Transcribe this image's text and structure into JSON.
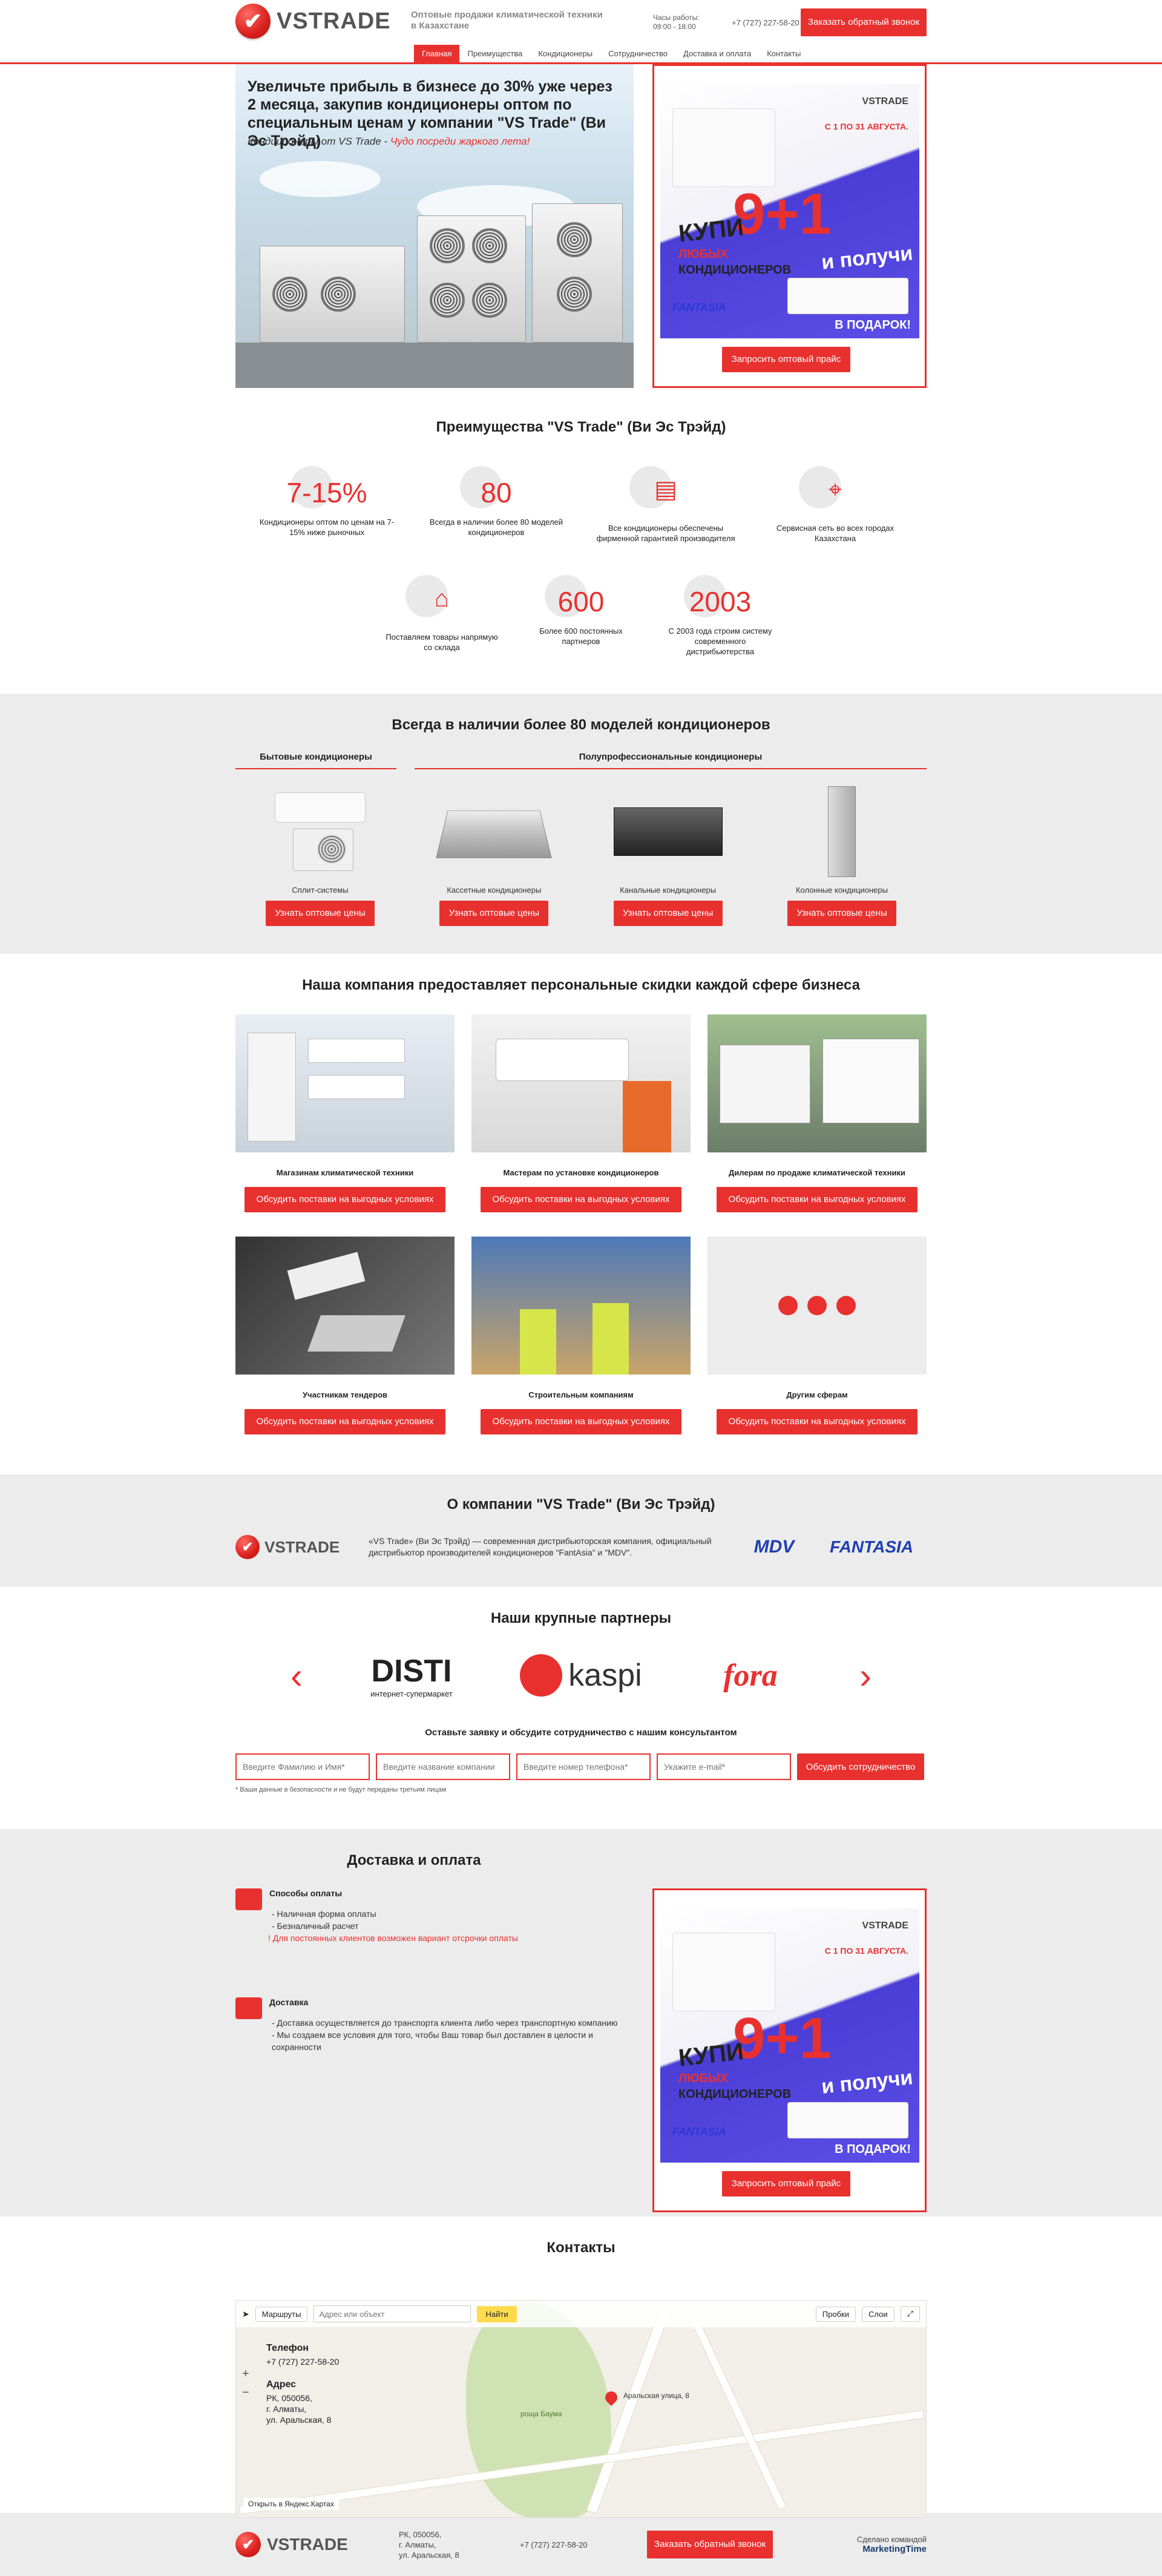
{
  "header": {
    "logo": "VSTRADE",
    "tagline": "Оптовые продажи климатической техники в Казахстане",
    "hours_label": "Часы работы:",
    "hours": "09:00 - 18:00",
    "phone": "+7 (727) 227-58-20",
    "callback_button": "Заказать обратный звонок",
    "nav": [
      "Главная",
      "Преимущества",
      "Кондиционеры",
      "Сотрудничество",
      "Доставка и оплата",
      "Контакты"
    ]
  },
  "hero": {
    "title": "Увеличьте прибыль в бизнесе до 30% уже через 2 месяца, закупив кондиционеры оптом по специальным ценам у компании \"VS Trade\" (Ви Эс Трэйд)",
    "subtitle_a": "Кондиционеры от VS Trade - ",
    "subtitle_b": "Чудо посреди жаркого лета!"
  },
  "promo": {
    "logo": "VSTRADE",
    "date": "С 1 ПО 31 АВГУСТА.",
    "buy": "КУПИ",
    "big": "9+1",
    "any": "ЛЮБЫХ",
    "conditioners": "КОНДИЦИОНЕРОВ",
    "get": "и получи",
    "gift": "В ПОДАРОК!",
    "brand": "FANTASIA",
    "button": "Запросить оптовый прайс"
  },
  "advantages": {
    "title": "Преимущества \"VS Trade\" (Ви Эс Трэйд)",
    "items": [
      {
        "value": "7-15%",
        "caption": "Кондиционеры оптом по ценам на 7-15% ниже рыночных"
      },
      {
        "value": "80",
        "caption": "Всегда в наличии более 80 моделей кондиционеров"
      },
      {
        "icon": "document-icon",
        "caption": "Все кондиционеры обеспечены фирменной гарантией производителя"
      },
      {
        "icon": "map-icon",
        "caption": "Сервисная сеть во всех городах Казахстана"
      },
      {
        "icon": "warehouse-icon",
        "caption": "Поставляем товары напрямую со склада"
      },
      {
        "value": "600",
        "caption": "Более 600 постоянных партнеров"
      },
      {
        "value": "2003",
        "caption": "С 2003 года строим систему современного дистрибьютерства"
      }
    ]
  },
  "models": {
    "title": "Всегда в наличии более 80 моделей кондиционеров",
    "cat_home": "Бытовые кондиционеры",
    "cat_semi": "Полупрофессиональные кондиционеры",
    "button": "Узнать оптовые цены",
    "items": [
      "Сплит-системы",
      "Кассетные кондиционеры",
      "Канальные кондиционеры",
      "Колонные кондиционеры"
    ]
  },
  "business": {
    "title": "Наша компания предоставляет персональные скидки каждой сфере бизнеса",
    "button": "Обсудить поставки на выгодных условиях",
    "items": [
      "Магазинам климатической техники",
      "Мастерам по установке кондиционеров",
      "Дилерам по продаже климатической техники",
      "Участникам тендеров",
      "Строительным компаниям",
      "Другим сферам"
    ]
  },
  "about": {
    "title": "О компании \"VS Trade\" (Ви Эс Трэйд)",
    "logo": "VSTRADE",
    "text": "«VS Trade» (Ви Эс Трэйд) — современная дистрибьюторская компания, официальный дистрибьютор производителей кондиционеров \"FantAsia\" и \"MDV\".",
    "mdv": "MDV",
    "fantasia": "FANTASIA"
  },
  "partners": {
    "title": "Наши крупные партнеры",
    "logos": [
      "DISTI",
      "kaspi",
      "fora"
    ],
    "disti_sub": "интернет-супермаркет",
    "form_title": "Оставьте заявку и обсудите сотрудничество с нашим консультантом",
    "placeholders": [
      "Введите Фамилию и Имя*",
      "Введите название компании",
      "Введите номер телефона*",
      "Укажите e-mail*"
    ],
    "submit": "Обсудить сотрудничество",
    "note": "* Ваши данные в безопасности и не будут переданы третьим лицам"
  },
  "delivery": {
    "title": "Доставка и оплата",
    "pay_title": "Способы оплаты",
    "pay_items": [
      "- Наличная форма оплаты",
      "- Безналичный расчет"
    ],
    "pay_warn": "! Для постоянных клиентов возможен вариант отсрочки оплаты",
    "del_title": "Доставка",
    "del_items": [
      "- Доставка осуществляется до транспорта клиента либо через транспортную компанию",
      "- Мы создаем все условия для того, чтобы Ваш товар был доставлен в целости и сохранности"
    ]
  },
  "contacts": {
    "title": "Контакты",
    "routes": "Маршруты",
    "search_placeholder": "Адрес или объект",
    "find": "Найти",
    "traffic": "Пробки",
    "layers": "Слои",
    "phone_label": "Телефон",
    "phone": "+7 (727) 227-58-20",
    "addr_label": "Адрес",
    "addr": [
      "РК, 050056,",
      "г. Алматы,",
      "ул. Аральская, 8"
    ],
    "pin_label": "Аральская улица, 8",
    "park": "роща Баума",
    "open": "Открыть в Яндекс.Картах"
  },
  "footer": {
    "logo": "VSTRADE",
    "addr": [
      "РК, 050056,",
      "г. Алматы,",
      "ул. Аральская, 8"
    ],
    "phone": "+7 (727) 227-58-20",
    "button": "Заказать обратный звонок",
    "made_label": "Сделано командой",
    "made_by": "MarketingTime"
  },
  "colors": {
    "accent": "#e8312f",
    "grey_bg": "#ececec"
  }
}
